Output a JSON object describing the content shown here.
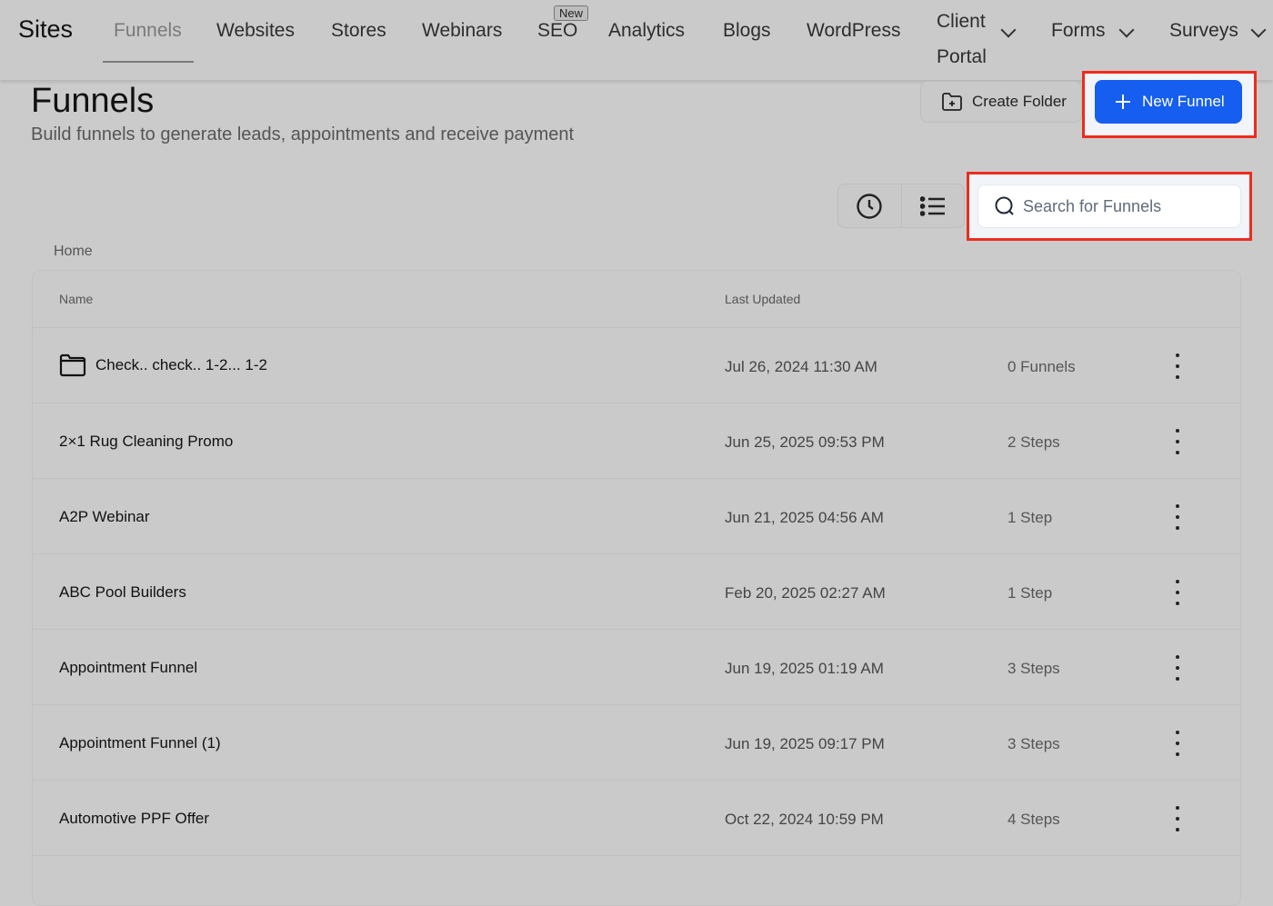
{
  "nav": {
    "brand": "Sites",
    "items": [
      "Funnels",
      "Websites",
      "Stores",
      "Webinars",
      "SEO",
      "Analytics",
      "Blogs",
      "WordPress"
    ],
    "seo_badge": "New",
    "client_portal_1": "Client",
    "client_portal_2": "Portal",
    "forms": "Forms",
    "surveys": "Surveys"
  },
  "page": {
    "title": "Funnels",
    "subtitle": "Build funnels to generate leads, appointments and receive payment",
    "create_folder": "Create Folder",
    "new_funnel": "New Funnel",
    "search_placeholder": "Search for Funnels",
    "breadcrumb": "Home"
  },
  "table": {
    "headers": {
      "name": "Name",
      "updated": "Last Updated"
    },
    "rows": [
      {
        "name": "Check.. check.. 1-2... 1-2",
        "updated": "Jul 26, 2024 11:30 AM",
        "count": "0 Funnels",
        "folder": true
      },
      {
        "name": "2×1 Rug Cleaning Promo",
        "updated": "Jun 25, 2025 09:53 PM",
        "count": "2 Steps"
      },
      {
        "name": "A2P Webinar",
        "updated": "Jun 21, 2025 04:56 AM",
        "count": "1 Step"
      },
      {
        "name": "ABC Pool Builders",
        "updated": "Feb 20, 2025 02:27 AM",
        "count": "1 Step"
      },
      {
        "name": "Appointment Funnel",
        "updated": "Jun 19, 2025 01:19 AM",
        "count": "3 Steps"
      },
      {
        "name": "Appointment Funnel (1)",
        "updated": "Jun 19, 2025 09:17 PM",
        "count": "3 Steps"
      },
      {
        "name": "Automotive PPF Offer",
        "updated": "Oct 22, 2024 10:59 PM",
        "count": "4 Steps"
      }
    ]
  },
  "colors": {
    "primary": "#155eef",
    "highlight": "#ee2b1e"
  }
}
